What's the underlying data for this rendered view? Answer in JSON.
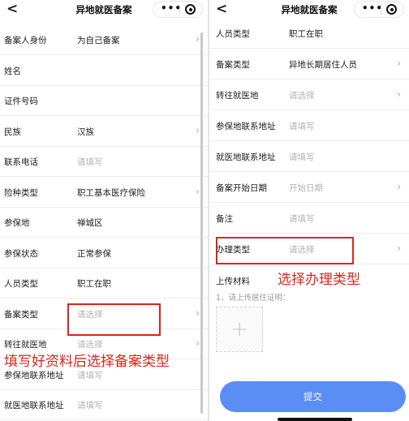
{
  "left": {
    "nav": {
      "back": "<",
      "title": "异地就医备案",
      "more": "•••"
    },
    "rows": [
      {
        "label": "备案人身份",
        "value": "为自己备案",
        "placeholder": false,
        "arrow": true
      },
      {
        "label": "姓名",
        "value": "",
        "placeholder": false,
        "arrow": false
      },
      {
        "label": "证件号码",
        "value": "",
        "placeholder": false,
        "arrow": false
      },
      {
        "label": "民族",
        "value": "汉族",
        "placeholder": false,
        "arrow": true
      },
      {
        "label": "联系电话",
        "value": "请填写",
        "placeholder": true,
        "arrow": false
      },
      {
        "label": "险种类型",
        "value": "职工基本医疗保险",
        "placeholder": false,
        "arrow": true
      },
      {
        "label": "参保地",
        "value": "禅城区",
        "placeholder": false,
        "arrow": false
      },
      {
        "label": "参保状态",
        "value": "正常参保",
        "placeholder": false,
        "arrow": false
      },
      {
        "label": "人员类型",
        "value": "职工在职",
        "placeholder": false,
        "arrow": false
      },
      {
        "label": "备案类型",
        "value": "请选择",
        "placeholder": true,
        "arrow": true
      },
      {
        "label": "转往就医地",
        "value": "请选择",
        "placeholder": true,
        "arrow": true
      },
      {
        "label": "参保地联系地址",
        "value": "请填写",
        "placeholder": true,
        "arrow": false
      },
      {
        "label": "就医地联系地址",
        "value": "请填写",
        "placeholder": true,
        "arrow": false
      }
    ],
    "annotation": "填写好资料后选择备案类型"
  },
  "right": {
    "nav": {
      "back": "<",
      "title": "异地就医备案",
      "more": "•••"
    },
    "rows": [
      {
        "label": "人员类型",
        "value": "职工在职",
        "placeholder": false,
        "arrow": false
      },
      {
        "label": "备案类型",
        "value": "异地长期居住人员",
        "placeholder": false,
        "arrow": true
      },
      {
        "label": "转往就医地",
        "value": "请选择",
        "placeholder": true,
        "arrow": true
      },
      {
        "label": "参保地联系地址",
        "value": "请填写",
        "placeholder": true,
        "arrow": false
      },
      {
        "label": "就医地联系地址",
        "value": "请填写",
        "placeholder": true,
        "arrow": false
      },
      {
        "label": "备案开始日期",
        "value": "开始日期",
        "placeholder": true,
        "arrow": true
      },
      {
        "label": "备注",
        "value": "请填写",
        "placeholder": true,
        "arrow": false
      },
      {
        "label": "办理类型",
        "value": "请选择",
        "placeholder": true,
        "arrow": true
      }
    ],
    "annotation": "选择办理类型",
    "upload": {
      "label": "上传材料",
      "hint": "1、请上传居住证明：",
      "plus": "+"
    },
    "submit": "提交"
  },
  "icons": {
    "arrow": "›",
    "target": "target-icon"
  },
  "colors": {
    "annotation": "#e0231c",
    "submit": "#5a8ef5",
    "placeholder": "#b3b3b3"
  }
}
